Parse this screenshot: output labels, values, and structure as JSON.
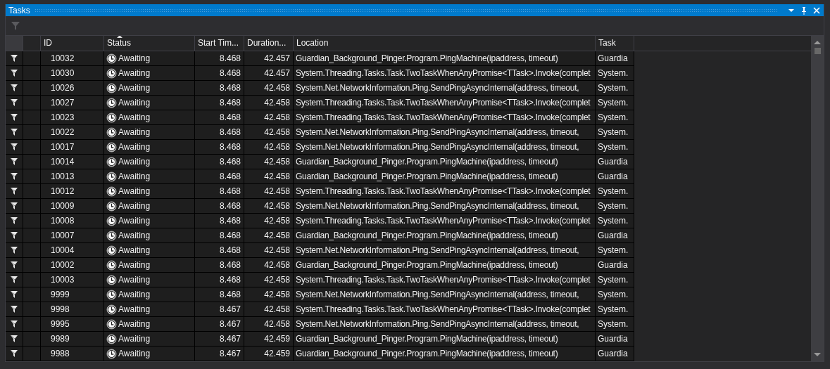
{
  "window": {
    "title": "Tasks"
  },
  "table": {
    "columns": [
      {
        "label": "ID",
        "sorted": false
      },
      {
        "label": "Status",
        "sorted": true
      },
      {
        "label": "Start Tim...",
        "sorted": false
      },
      {
        "label": "Duration...",
        "sorted": false
      },
      {
        "label": "Location",
        "sorted": false
      },
      {
        "label": "Task",
        "sorted": false
      }
    ],
    "rows": [
      {
        "id": "10032",
        "status": "Awaiting",
        "start": "8.468",
        "duration": "42.457",
        "location": "Guardian_Background_Pinger.Program.PingMachine(ipaddress, timeout)",
        "task": "Guardia"
      },
      {
        "id": "10030",
        "status": "Awaiting",
        "start": "8.468",
        "duration": "42.457",
        "location": "System.Threading.Tasks.Task.TwoTaskWhenAnyPromise<TTask>.Invoke(complet",
        "task": "System."
      },
      {
        "id": "10026",
        "status": "Awaiting",
        "start": "8.468",
        "duration": "42.458",
        "location": "System.Net.NetworkInformation.Ping.SendPingAsyncInternal(address, timeout,",
        "task": "System."
      },
      {
        "id": "10027",
        "status": "Awaiting",
        "start": "8.468",
        "duration": "42.458",
        "location": "System.Threading.Tasks.Task.TwoTaskWhenAnyPromise<TTask>.Invoke(complet",
        "task": "System."
      },
      {
        "id": "10023",
        "status": "Awaiting",
        "start": "8.468",
        "duration": "42.458",
        "location": "System.Threading.Tasks.Task.TwoTaskWhenAnyPromise<TTask>.Invoke(complet",
        "task": "System."
      },
      {
        "id": "10022",
        "status": "Awaiting",
        "start": "8.468",
        "duration": "42.458",
        "location": "System.Net.NetworkInformation.Ping.SendPingAsyncInternal(address, timeout,",
        "task": "System."
      },
      {
        "id": "10017",
        "status": "Awaiting",
        "start": "8.468",
        "duration": "42.458",
        "location": "System.Net.NetworkInformation.Ping.SendPingAsyncInternal(address, timeout,",
        "task": "System."
      },
      {
        "id": "10014",
        "status": "Awaiting",
        "start": "8.468",
        "duration": "42.458",
        "location": "Guardian_Background_Pinger.Program.PingMachine(ipaddress, timeout)",
        "task": "Guardia"
      },
      {
        "id": "10013",
        "status": "Awaiting",
        "start": "8.468",
        "duration": "42.458",
        "location": "Guardian_Background_Pinger.Program.PingMachine(ipaddress, timeout)",
        "task": "Guardia"
      },
      {
        "id": "10012",
        "status": "Awaiting",
        "start": "8.468",
        "duration": "42.458",
        "location": "System.Threading.Tasks.Task.TwoTaskWhenAnyPromise<TTask>.Invoke(complet",
        "task": "System."
      },
      {
        "id": "10009",
        "status": "Awaiting",
        "start": "8.468",
        "duration": "42.458",
        "location": "System.Net.NetworkInformation.Ping.SendPingAsyncInternal(address, timeout,",
        "task": "System."
      },
      {
        "id": "10008",
        "status": "Awaiting",
        "start": "8.468",
        "duration": "42.458",
        "location": "System.Threading.Tasks.Task.TwoTaskWhenAnyPromise<TTask>.Invoke(complet",
        "task": "System."
      },
      {
        "id": "10007",
        "status": "Awaiting",
        "start": "8.468",
        "duration": "42.458",
        "location": "Guardian_Background_Pinger.Program.PingMachine(ipaddress, timeout)",
        "task": "Guardia"
      },
      {
        "id": "10004",
        "status": "Awaiting",
        "start": "8.468",
        "duration": "42.458",
        "location": "System.Net.NetworkInformation.Ping.SendPingAsyncInternal(address, timeout,",
        "task": "System."
      },
      {
        "id": "10002",
        "status": "Awaiting",
        "start": "8.468",
        "duration": "42.458",
        "location": "Guardian_Background_Pinger.Program.PingMachine(ipaddress, timeout)",
        "task": "Guardia"
      },
      {
        "id": "10003",
        "status": "Awaiting",
        "start": "8.468",
        "duration": "42.458",
        "location": "System.Threading.Tasks.Task.TwoTaskWhenAnyPromise<TTask>.Invoke(complet",
        "task": "System."
      },
      {
        "id": "9999",
        "status": "Awaiting",
        "start": "8.468",
        "duration": "42.458",
        "location": "System.Net.NetworkInformation.Ping.SendPingAsyncInternal(address, timeout,",
        "task": "System."
      },
      {
        "id": "9998",
        "status": "Awaiting",
        "start": "8.467",
        "duration": "42.458",
        "location": "System.Threading.Tasks.Task.TwoTaskWhenAnyPromise<TTask>.Invoke(complet",
        "task": "System."
      },
      {
        "id": "9995",
        "status": "Awaiting",
        "start": "8.467",
        "duration": "42.458",
        "location": "System.Net.NetworkInformation.Ping.SendPingAsyncInternal(address, timeout,",
        "task": "System."
      },
      {
        "id": "9989",
        "status": "Awaiting",
        "start": "8.467",
        "duration": "42.459",
        "location": "Guardian_Background_Pinger.Program.PingMachine(ipaddress, timeout)",
        "task": "Guardia"
      },
      {
        "id": "9988",
        "status": "Awaiting",
        "start": "8.467",
        "duration": "42.459",
        "location": "Guardian_Background_Pinger.Program.PingMachine(ipaddress, timeout)",
        "task": "Guardia"
      }
    ]
  }
}
